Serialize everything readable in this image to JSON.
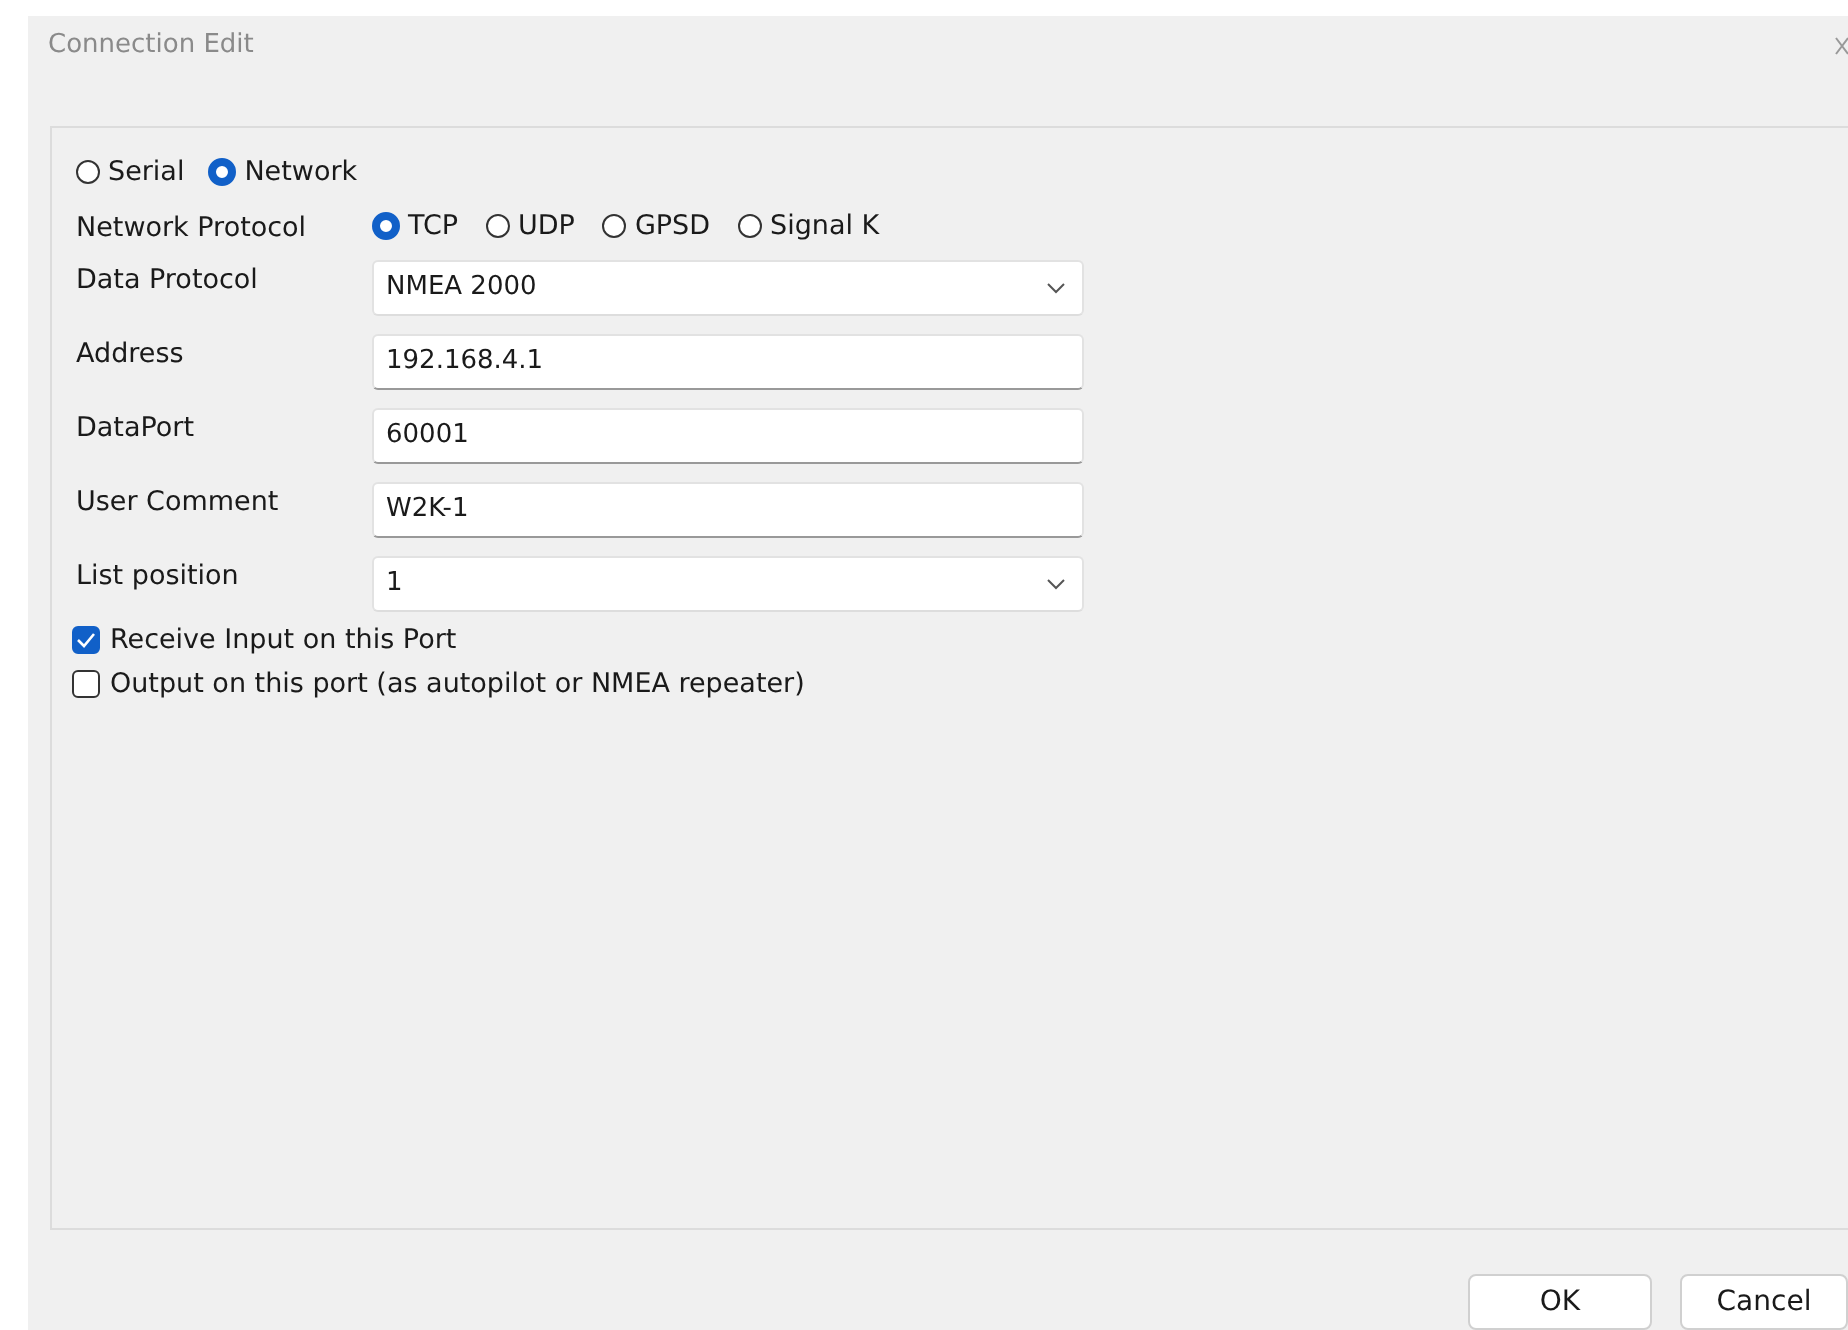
{
  "window": {
    "title": "Connection Edit"
  },
  "connection_type": [
    {
      "label": "Serial",
      "selected": false
    },
    {
      "label": "Network",
      "selected": true
    }
  ],
  "network_protocol": {
    "label": "Network Protocol",
    "options": [
      {
        "label": "TCP",
        "selected": true
      },
      {
        "label": "UDP",
        "selected": false
      },
      {
        "label": "GPSD",
        "selected": false
      },
      {
        "label": "Signal K",
        "selected": false
      }
    ]
  },
  "fields": [
    {
      "label": "Data Protocol",
      "kind": "dropdown",
      "value": "NMEA 2000"
    },
    {
      "label": "Address",
      "kind": "text",
      "value": "192.168.4.1"
    },
    {
      "label": "DataPort",
      "kind": "text",
      "value": "60001"
    },
    {
      "label": "User Comment",
      "kind": "text",
      "value": "W2K-1"
    },
    {
      "label": "List position",
      "kind": "dropdown",
      "value": "1"
    }
  ],
  "checkboxes": [
    {
      "label": "Receive Input on this Port",
      "checked": true
    },
    {
      "label": "Output on this port (as autopilot or NMEA repeater)",
      "checked": false
    }
  ],
  "buttons": [
    "OK",
    "Cancel"
  ]
}
